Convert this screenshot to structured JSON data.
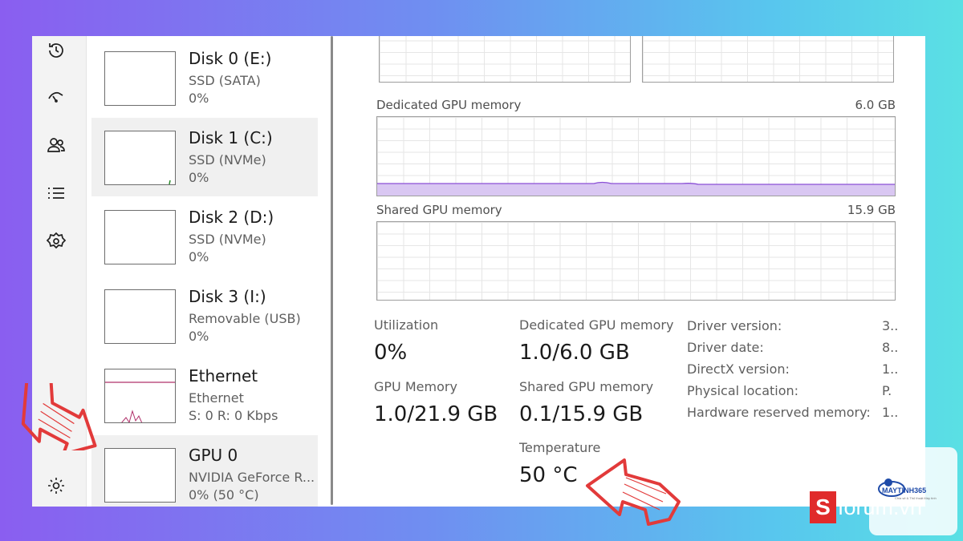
{
  "devices": [
    {
      "name": "Disk 0 (E:)",
      "sub": "SSD (SATA)",
      "value": "0%"
    },
    {
      "name": "Disk 1 (C:)",
      "sub": "SSD (NVMe)",
      "value": "0%"
    },
    {
      "name": "Disk 2 (D:)",
      "sub": "SSD (NVMe)",
      "value": "0%"
    },
    {
      "name": "Disk 3 (I:)",
      "sub": "Removable (USB)",
      "value": "0%"
    },
    {
      "name": "Ethernet",
      "sub": "Ethernet",
      "value": "S: 0 R: 0 Kbps"
    },
    {
      "name": "GPU 0",
      "sub": "NVIDIA GeForce R...",
      "value": "0% (50 °C)"
    }
  ],
  "graphs": {
    "dedicated": {
      "label": "Dedicated GPU memory",
      "max": "6.0 GB"
    },
    "shared": {
      "label": "Shared GPU memory",
      "max": "15.9 GB"
    }
  },
  "stats": {
    "utilization": {
      "label": "Utilization",
      "value": "0%"
    },
    "dedicated": {
      "label": "Dedicated GPU memory",
      "value": "1.0/6.0 GB"
    },
    "gpu_memory": {
      "label": "GPU Memory",
      "value": "1.0/21.9 GB"
    },
    "shared": {
      "label": "Shared GPU memory",
      "value": "0.1/15.9 GB"
    },
    "temperature": {
      "label": "Temperature",
      "value": "50 °C"
    }
  },
  "info": [
    {
      "label": "Driver version:",
      "value": "3.."
    },
    {
      "label": "Driver date:",
      "value": "8.."
    },
    {
      "label": "DirectX version:",
      "value": "1.."
    },
    {
      "label": "Physical location:",
      "value": "P."
    },
    {
      "label": "Hardware reserved memory:",
      "value": "1.."
    }
  ],
  "rail_icons": [
    "history-icon",
    "startup-apps-icon",
    "users-icon",
    "details-icon",
    "services-icon",
    "settings-icon"
  ],
  "watermarks": {
    "forum": "forum.vn",
    "forum_s": "S",
    "logo_brand": "MAYTINH365",
    "logo_tag": "Chia sẻ & Thủ thuật Máy tính"
  },
  "colors": {
    "arrow": "#e23a3a",
    "memory_fill": "#d9c7f2",
    "memory_line": "#8a4fd6",
    "ethernet_line": "#b0306a"
  }
}
